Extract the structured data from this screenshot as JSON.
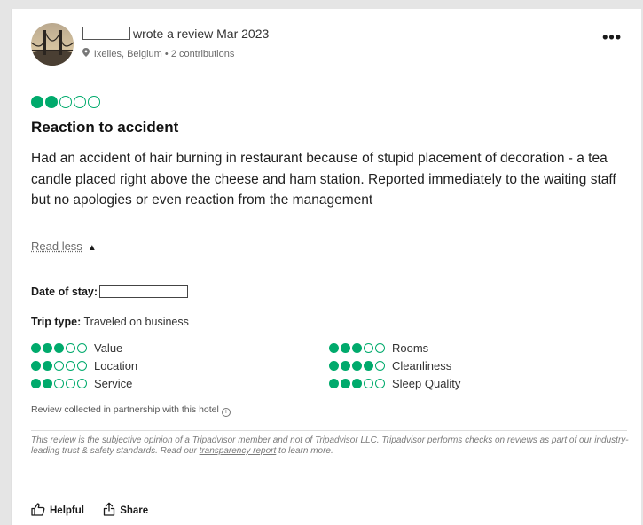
{
  "reviewer": {
    "action_text": "wrote a review Mar 2023",
    "location": "Ixelles, Belgium",
    "separator": "•",
    "contributions": "2 contributions"
  },
  "more_label": "•••",
  "rating": {
    "filled": 2,
    "total": 5
  },
  "review": {
    "title": "Reaction to accident",
    "body": "Had an accident of hair burning in restaurant because of stupid placement of decoration - a tea candle placed right above the cheese and ham station. Reported immediately to the waiting staff but no apologies or even reaction from the management",
    "read_less": "Read less"
  },
  "date_of_stay_label": "Date of stay:",
  "trip_type": {
    "label": "Trip type:",
    "value": "Traveled on business"
  },
  "sub_ratings": [
    {
      "label": "Value",
      "filled": 3
    },
    {
      "label": "Location",
      "filled": 2
    },
    {
      "label": "Service",
      "filled": 2
    },
    {
      "label": "Rooms",
      "filled": 3
    },
    {
      "label": "Cleanliness",
      "filled": 4
    },
    {
      "label": "Sleep Quality",
      "filled": 3
    }
  ],
  "collected_text": "Review collected in partnership with this hotel",
  "disclaimer": {
    "text": "This review is the subjective opinion of a Tripadvisor member and not of Tripadvisor LLC. Tripadvisor performs checks on reviews as part of our industry-leading trust & safety standards. Read our ",
    "link": "transparency report",
    "suffix": " to learn more."
  },
  "actions": {
    "helpful": "Helpful",
    "share": "Share"
  },
  "icons": {
    "location": "pin-icon",
    "info": "info-icon",
    "helpful": "thumbs-up-icon",
    "share": "share-icon",
    "more": "more-icon"
  },
  "colors": {
    "rating_green": "#00aa6c"
  }
}
